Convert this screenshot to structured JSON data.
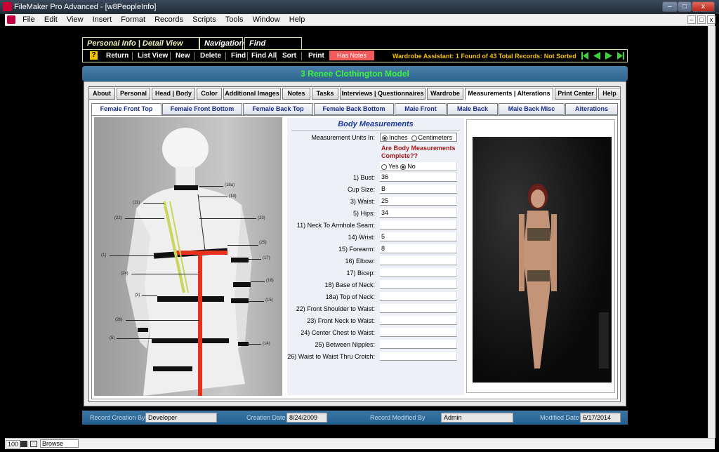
{
  "window": {
    "title": "FileMaker Pro Advanced - [w8PeopleInfo]",
    "min": "–",
    "max": "□",
    "close": "x"
  },
  "menu": [
    "File",
    "Edit",
    "View",
    "Insert",
    "Format",
    "Records",
    "Scripts",
    "Tools",
    "Window",
    "Help"
  ],
  "mdi": [
    "–",
    "□",
    "x"
  ],
  "toolbar_tabs": [
    "Personal Info | Detail View Toolbar",
    "Navigation",
    "Find Functions"
  ],
  "toolbar": {
    "help": "?",
    "buttons": [
      "Return",
      "List View",
      "New",
      "Delete",
      "Find",
      "Find All",
      "Sort",
      "Print"
    ],
    "has_notes": "Has Notes",
    "status": "Wardrobe Assistant:  1 Found of 43 Total Records: Not Sorted"
  },
  "record_header": "3     Renee Clothington     Model",
  "tabs": [
    "About",
    "Personal",
    "Head | Body",
    "Color",
    "Additional Images",
    "Notes",
    "Tasks",
    "Interviews | Questionnaires",
    "Wardrobe",
    "Measurements | Alterations",
    "Print Center",
    "Help"
  ],
  "subtabs": [
    "Female Front Top",
    "Female Front Bottom",
    "Female Back Top",
    "Female Back Bottom",
    "Male Front",
    "Male Back",
    "Male Back Misc",
    "Alterations"
  ],
  "form": {
    "heading": "Body Measurements",
    "units_label": "Measurement Units In:",
    "units": [
      "Inches",
      "Centimeters"
    ],
    "complete_q": "Are Body Measurements Complete??",
    "complete_opts": [
      "Yes",
      "No"
    ],
    "fields": [
      {
        "label": "1) Bust:",
        "value": "36"
      },
      {
        "label": "Cup Size:",
        "value": "B"
      },
      {
        "label": "3) Waist:",
        "value": "25"
      },
      {
        "label": "5) Hips:",
        "value": "34"
      },
      {
        "label": "11) Neck To Armhole Seam:",
        "value": ""
      },
      {
        "label": "14) Wrist:",
        "value": "5"
      },
      {
        "label": "15) Forearm:",
        "value": "8"
      },
      {
        "label": "16) Elbow:",
        "value": ""
      },
      {
        "label": "17) Bicep:",
        "value": ""
      },
      {
        "label": "18) Base of Neck:",
        "value": ""
      },
      {
        "label": "18a) Top of Neck:",
        "value": ""
      },
      {
        "label": "22) Front Shoulder to Waist:",
        "value": ""
      },
      {
        "label": "23) Front Neck to Waist:",
        "value": ""
      },
      {
        "label": "24) Center Chest to Waist:",
        "value": ""
      },
      {
        "label": "25) Between Nipples:",
        "value": ""
      },
      {
        "label": "26) Waist to Waist Thru Crotch:",
        "value": ""
      }
    ]
  },
  "mannequin_labels": [
    "(18a)",
    "(18)",
    "(11)",
    "(22)",
    "(23)",
    "(25)",
    "(1)",
    "(17)",
    "(24)",
    "(16)",
    "(3)",
    "(15)",
    "(26)",
    "(5)",
    "(14)"
  ],
  "footer": {
    "created_by_label": "Record Creation By",
    "created_by": "Developer",
    "creation_date_label": "Creation Date",
    "creation_date": "8/24/2009",
    "modified_by_label": "Record Modified By",
    "modified_by": "Admin",
    "modified_date_label": "Modified Date",
    "modified_date": "6/17/2014"
  },
  "statusbar": {
    "zoom": "100",
    "mode": "Browse"
  },
  "colors": {
    "accent_green": "#3df53d",
    "header_blue": "#2c6590",
    "notes_red": "#f25b5b",
    "status_yellow": "#f3c300"
  }
}
